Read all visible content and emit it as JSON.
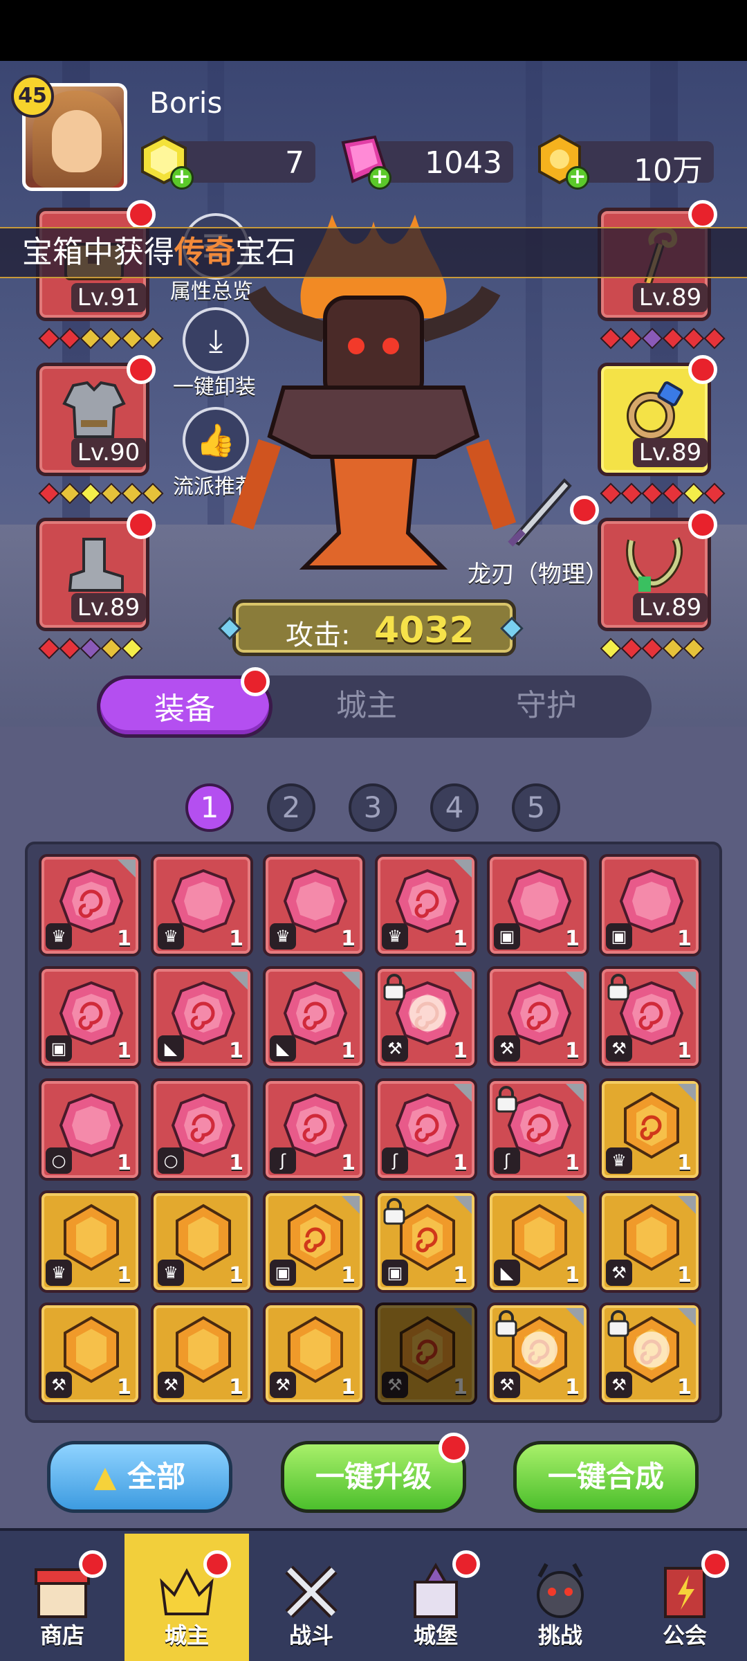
{
  "player": {
    "level": "45",
    "name": "Boris"
  },
  "resources": [
    {
      "icon": "yellow-gem-icon",
      "value": "7"
    },
    {
      "icon": "pink-gem-icon",
      "value": "1043"
    },
    {
      "icon": "gold-coin-icon",
      "value": "10万"
    }
  ],
  "banner": {
    "prefix": "宝箱中获得",
    "highlight": "传奇",
    "suffix": "宝石"
  },
  "left_slots": [
    {
      "icon": "chest-icon",
      "level": "Lv.91"
    },
    {
      "icon": "armor-icon",
      "level": "Lv.90"
    },
    {
      "icon": "boots-icon",
      "level": "Lv.89"
    }
  ],
  "right_slots": [
    {
      "icon": "staff-icon",
      "level": "Lv.89"
    },
    {
      "icon": "ring-icon",
      "level": "Lv.89"
    },
    {
      "icon": "necklace-icon",
      "level": "Lv.89"
    }
  ],
  "side_buttons": [
    {
      "icon": "stats-icon",
      "label": "属性总览"
    },
    {
      "icon": "unequip-icon",
      "label": "一键卸装"
    },
    {
      "icon": "thumbs-up-icon",
      "label": "流派推荐"
    }
  ],
  "weapon": {
    "label": "龙刃（物理）"
  },
  "attack": {
    "label": "攻击:",
    "value": "4032"
  },
  "tabs": [
    "装备",
    "城主",
    "守护"
  ],
  "pages": [
    "1",
    "2",
    "3",
    "4",
    "5"
  ],
  "buttons": {
    "all": "全部",
    "upgrade": "一键升级",
    "merge": "一键合成"
  },
  "nav": [
    "商店",
    "城主",
    "战斗",
    "城堡",
    "挑战",
    "公会"
  ],
  "colors": {
    "accent_purple": "#b44ff0",
    "red_dot": "#e8222c",
    "nav_active": "#f2cf3b"
  },
  "gems": [
    [
      {
        "c": "r",
        "t": "♛",
        "n": "1",
        "s": 1
      },
      {
        "c": "r",
        "t": "♛",
        "n": "1",
        "s": 0
      },
      {
        "c": "r",
        "t": "♛",
        "n": "1",
        "s": 0
      },
      {
        "c": "r",
        "t": "♛",
        "n": "1",
        "s": 1
      },
      {
        "c": "r",
        "t": "▣",
        "n": "1",
        "s": 0
      },
      {
        "c": "r",
        "t": "▣",
        "n": "1",
        "s": 0
      }
    ],
    [
      {
        "c": "r",
        "t": "▣",
        "n": "1",
        "s": 1
      },
      {
        "c": "r",
        "t": "◣",
        "n": "1",
        "s": 1
      },
      {
        "c": "r",
        "t": "◣",
        "n": "1",
        "s": 1
      },
      {
        "c": "r",
        "t": "⚒",
        "n": "1",
        "s": 2
      },
      {
        "c": "r",
        "t": "⚒",
        "n": "1",
        "s": 1
      },
      {
        "c": "r",
        "t": "⚒",
        "n": "1",
        "s": 1
      }
    ],
    [
      {
        "c": "r",
        "t": "○",
        "n": "1",
        "s": 0
      },
      {
        "c": "r",
        "t": "○",
        "n": "1",
        "s": 1
      },
      {
        "c": "r",
        "t": "ʃ",
        "n": "1",
        "s": 1
      },
      {
        "c": "r",
        "t": "ʃ",
        "n": "1",
        "s": 1
      },
      {
        "c": "r",
        "t": "ʃ",
        "n": "1",
        "s": 1
      },
      {
        "c": "y",
        "t": "♛",
        "n": "1",
        "s": 1
      }
    ],
    [
      {
        "c": "y",
        "t": "♛",
        "n": "1",
        "s": 0
      },
      {
        "c": "y",
        "t": "♛",
        "n": "1",
        "s": 0
      },
      {
        "c": "y",
        "t": "▣",
        "n": "1",
        "s": 1
      },
      {
        "c": "y",
        "t": "▣",
        "n": "1",
        "s": 1
      },
      {
        "c": "y",
        "t": "◣",
        "n": "1",
        "s": 0
      },
      {
        "c": "y",
        "t": "⚒",
        "n": "1",
        "s": 0
      }
    ],
    [
      {
        "c": "y",
        "t": "⚒",
        "n": "1",
        "s": 0
      },
      {
        "c": "y",
        "t": "⚒",
        "n": "1",
        "s": 0
      },
      {
        "c": "y",
        "t": "⚒",
        "n": "1",
        "s": 0
      },
      {
        "c": "y",
        "t": "⚒",
        "n": "1",
        "s": 1
      },
      {
        "c": "y",
        "t": "⚒",
        "n": "1",
        "s": 2
      },
      {
        "c": "y",
        "t": "⚒",
        "n": "1",
        "s": 2
      }
    ]
  ]
}
